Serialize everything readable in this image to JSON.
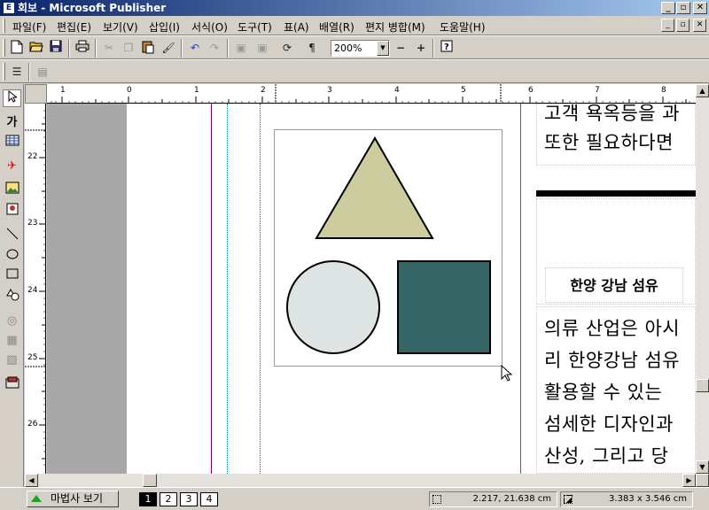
{
  "window": {
    "icon_letter": "E",
    "title": "회보 - Microsoft Publisher",
    "minimize": "_",
    "maximize": "▫",
    "close": "✕"
  },
  "menu": {
    "items": [
      "파일(F)",
      "편집(E)",
      "보기(V)",
      "삽입(I)",
      "서식(O)",
      "도구(T)",
      "표(A)",
      "배열(R)",
      "편지 병합(M)",
      "도움말(H)"
    ]
  },
  "toolbar": {
    "zoom": "200%",
    "zoom_out": "−",
    "zoom_in": "+"
  },
  "ruler": {
    "h_labels": [
      "1",
      "0",
      "1",
      "2",
      "3",
      "4",
      "5",
      "6",
      "7",
      "8"
    ],
    "v_labels": [
      "22",
      "23",
      "24",
      "25",
      "26"
    ]
  },
  "document": {
    "text_top_lines": [
      "고객 욕옥등을 과",
      "또한 필요하다면"
    ],
    "heading": "한양 강남 섬유",
    "text_body_lines": [
      "의류 산업은 아시",
      "리 한양강남 섬유",
      "활용할 수 있는",
      "섬세한 디자인과",
      "산성, 그리고 당"
    ]
  },
  "shapes": {
    "triangle": "triangle",
    "circle": "circle",
    "square": "square",
    "colors": {
      "triangle_fill": "#cccc9e",
      "circle_fill": "#dee3e4",
      "square_fill": "#356665"
    }
  },
  "status": {
    "wizard_label": "마법사 보기",
    "pages": [
      "1",
      "2",
      "3",
      "4"
    ],
    "active_page": "1",
    "position": "2.217, 21.638 cm",
    "size": "3.383 x  3.546 cm"
  }
}
